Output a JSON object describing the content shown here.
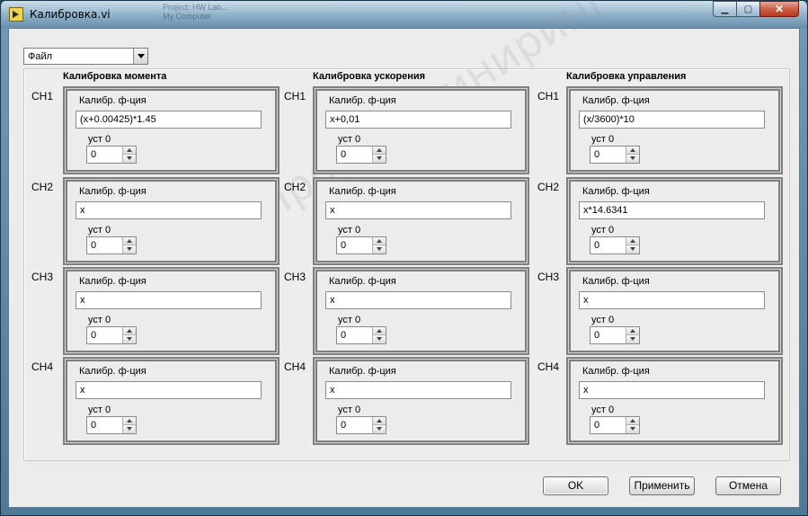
{
  "window": {
    "title": "Калибровка.vi",
    "background_ghost": [
      "Project: HW Lab...",
      "My Computer"
    ]
  },
  "menu": {
    "file_label": "Файл"
  },
  "groups": [
    {
      "title": "Калибровка момента",
      "channels": [
        {
          "ch": "CH1",
          "fn_label": "Калибр. ф-ция",
          "fn": "(x+0.00425)*1.45",
          "ust_label": "уст 0",
          "ust": "0"
        },
        {
          "ch": "CH2",
          "fn_label": "Калибр. ф-ция",
          "fn": "x",
          "ust_label": "уст 0",
          "ust": "0"
        },
        {
          "ch": "CH3",
          "fn_label": "Калибр. ф-ция",
          "fn": "x",
          "ust_label": "уст 0",
          "ust": "0"
        },
        {
          "ch": "CH4",
          "fn_label": "Калибр. ф-ция",
          "fn": "x",
          "ust_label": "уст 0",
          "ust": "0"
        }
      ]
    },
    {
      "title": "Калибровка ускорения",
      "channels": [
        {
          "ch": "CH1",
          "fn_label": "Калибр. ф-ция",
          "fn": "x+0,01",
          "ust_label": "уст 0",
          "ust": "0"
        },
        {
          "ch": "CH2",
          "fn_label": "Калибр. ф-ция",
          "fn": "x",
          "ust_label": "уст 0",
          "ust": "0"
        },
        {
          "ch": "CH3",
          "fn_label": "Калибр. ф-ция",
          "fn": "x",
          "ust_label": "уст 0",
          "ust": "0"
        },
        {
          "ch": "CH4",
          "fn_label": "Калибр. ф-ция",
          "fn": "x",
          "ust_label": "уст 0",
          "ust": "0"
        }
      ]
    },
    {
      "title": "Калибровка управления",
      "channels": [
        {
          "ch": "CH1",
          "fn_label": "Калибр. ф-ция",
          "fn": "(x/3600)*10",
          "ust_label": "уст 0",
          "ust": "0"
        },
        {
          "ch": "CH2",
          "fn_label": "Калибр. ф-ция",
          "fn": "x*14.6341",
          "ust_label": "уст 0",
          "ust": "0"
        },
        {
          "ch": "CH3",
          "fn_label": "Калибр. ф-ция",
          "fn": "x",
          "ust_label": "уст 0",
          "ust": "0"
        },
        {
          "ch": "CH4",
          "fn_label": "Калибр. ф-ция",
          "fn": "x",
          "ust_label": "уст 0",
          "ust": "0"
        }
      ]
    }
  ],
  "watermark": "ТехПромИнжиниринг",
  "buttons": {
    "ok": "OK",
    "apply": "Применить",
    "cancel": "Отмена"
  }
}
